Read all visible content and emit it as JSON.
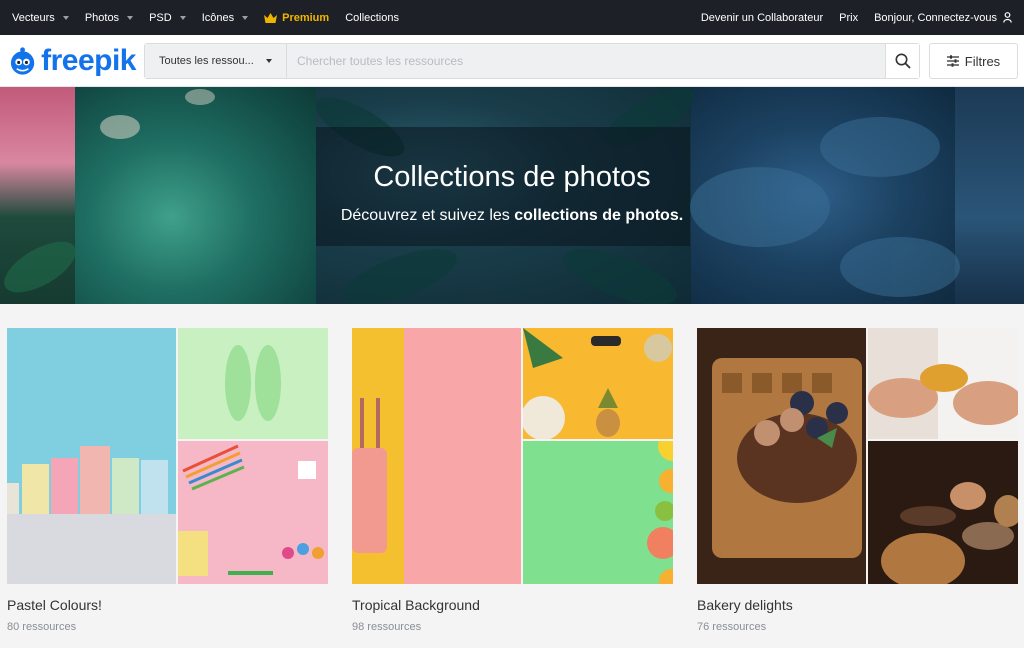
{
  "topnav": {
    "vecteurs": "Vecteurs",
    "photos": "Photos",
    "psd": "PSD",
    "icones": "Icônes",
    "premium": "Premium",
    "collections": "Collections",
    "collaborateur": "Devenir un Collaborateur",
    "prix": "Prix",
    "connect": "Bonjour, Connectez-vous"
  },
  "header": {
    "logo": "freepik",
    "resource_select": "Toutes les ressou...",
    "search_placeholder": "Chercher toutes les ressources",
    "filters": "Filtres"
  },
  "hero": {
    "title": "Collections de photos",
    "subtitle_prefix": "Découvrez et suivez les ",
    "subtitle_bold": "collections de photos."
  },
  "collections": [
    {
      "title": "Pastel Colours!",
      "count": "80 ressources"
    },
    {
      "title": "Tropical Background",
      "count": "98 ressources"
    },
    {
      "title": "Bakery delights",
      "count": "76 ressources"
    }
  ],
  "colors": {
    "topnav_bg": "#1d2127",
    "premium": "#f0b400",
    "brand_blue": "#1273eb"
  },
  "icons": [
    "caret-down-icon",
    "crown-icon",
    "user-icon",
    "search-icon",
    "filters-icon"
  ]
}
